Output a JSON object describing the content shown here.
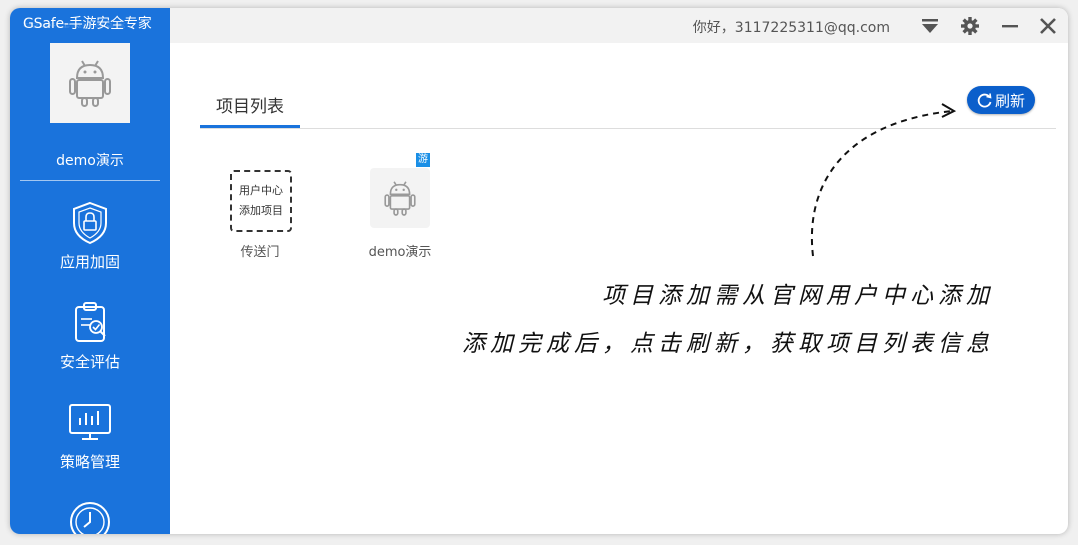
{
  "app": {
    "title": "GSafe-手游安全专家"
  },
  "project": {
    "name": "demo演示"
  },
  "sidebar": {
    "items": [
      {
        "label": "应用加固",
        "icon": "shield-lock-icon"
      },
      {
        "label": "安全评估",
        "icon": "clipboard-check-icon"
      },
      {
        "label": "策略管理",
        "icon": "monitor-chart-icon"
      },
      {
        "label": "",
        "icon": "clock-icon"
      }
    ]
  },
  "topbar": {
    "greeting": "你好，3117225311@qq.com",
    "icons": [
      "dropdown-icon",
      "settings-icon",
      "minimize-icon",
      "close-icon"
    ]
  },
  "main": {
    "tab": "项目列表",
    "refresh_label": "刷新",
    "cards": [
      {
        "lines": [
          "用户中心",
          "添加项目"
        ],
        "caption": "传送门",
        "icon": "dashed-add-card"
      },
      {
        "caption": "demo演示",
        "badge": "游",
        "icon": "android-icon"
      }
    ],
    "hint_line1": "项目添加需从官网用户中心添加",
    "hint_line2": "添加完成后，点击刷新，获取项目列表信息"
  },
  "colors": {
    "sidebar": "#1a73dc",
    "refresh": "#0b5fcb",
    "badge": "#1a8fe6"
  }
}
